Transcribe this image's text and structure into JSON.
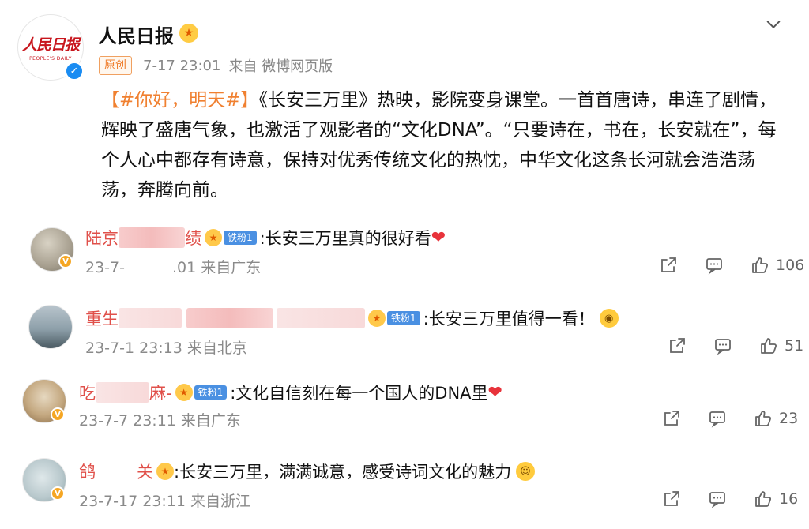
{
  "post": {
    "author": "人民日报",
    "avatar_logo_cn": "人民日报",
    "avatar_logo_en": "PEOPLE'S DAILY",
    "tag": "原创",
    "time": "7-17 23:01",
    "source": "来自 微博网页版",
    "hashtag": "【#你好，明天#】",
    "body": "《长安三万里》热映，影院变身课堂。一首首唐诗，串连了剧情，辉映了盛唐气象，也激活了观影者的“文化DNA”。“只要诗在，书在，长安就在”，每个人心中都存有诗意，保持对优秀传统文化的热忱，中华文化这条长河就会浩浩荡荡，奔腾向前。"
  },
  "comments": [
    {
      "name_start": "陆京",
      "name_end": "绩",
      "fan_badge": "铁粉1",
      "text": ":长安三万里真的很好看",
      "time_start": "23-7-",
      "time_end": ".01 来自广东",
      "likes": "106"
    },
    {
      "name_start": "重生",
      "name_end": "",
      "fan_badge": "铁粉1",
      "text": ":长安三万里值得一看！",
      "time": "23-7-1",
      "time_rest": " 23:13 来自北京",
      "likes": "51"
    },
    {
      "name_start": "吃",
      "name_end": "麻-",
      "fan_badge": "铁粉1",
      "text": ":文化自信刻在每一个国人的DNA里",
      "time": "23-7-",
      "time_rest": "7 23:11 来自广东",
      "likes": "23"
    },
    {
      "name_start": "鸽",
      "name_end": "关",
      "fan_badge": "",
      "text": ":长安三万里，满满诚意，感受诗词文化的魅力",
      "time": "23-7-",
      "time_rest": "17 23:11 来自浙江",
      "likes": "16"
    }
  ],
  "colors": {
    "accent_orange": "#f08030",
    "name_red": "#e0504a",
    "verified_blue": "#1a8cf2",
    "fan_badge_blue": "#4a90e2",
    "heart_red": "#e8333b"
  }
}
